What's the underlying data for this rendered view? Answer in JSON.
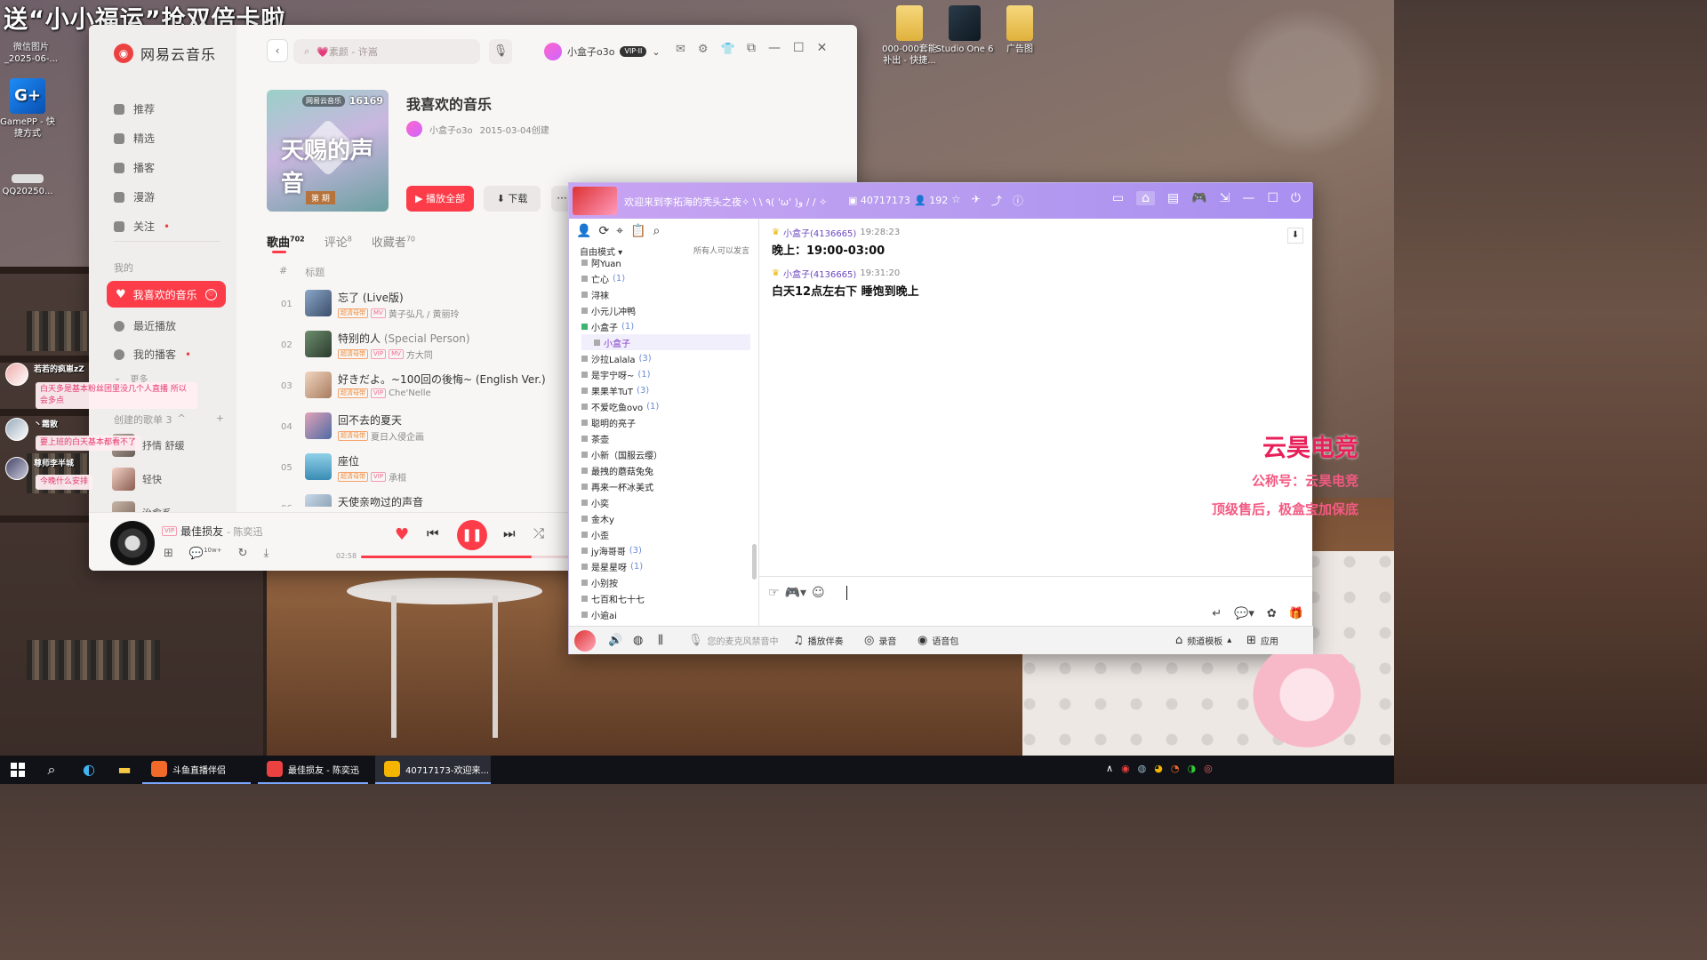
{
  "overlay": {
    "title": "送“小小福运”抢双倍卡啦"
  },
  "desktop": {
    "left_icons": [
      {
        "label": "微信图片_2025-06-..."
      },
      {
        "label": "GamePP - 快捷方式"
      },
      {
        "label": "QQ20250..."
      }
    ],
    "top_icons": [
      {
        "label": "000-000套能补出 - 快捷..."
      },
      {
        "label": "Studio One 6"
      },
      {
        "label": "广告图"
      }
    ]
  },
  "netease": {
    "app_name": "网易云音乐",
    "search_placeholder": "💗素颜 - 许嵩",
    "user_name": "小盒子o3o",
    "vip_label": "VIP·II",
    "nav": [
      {
        "label": "推荐",
        "icon": "home-icon"
      },
      {
        "label": "精选",
        "icon": "star-icon"
      },
      {
        "label": "播客",
        "icon": "radio-icon"
      },
      {
        "label": "漫游",
        "icon": "roam-icon"
      },
      {
        "label": "关注",
        "icon": "follow-icon",
        "dot": "•"
      }
    ],
    "my_section": "我的",
    "liked_label": "我喜欢的音乐",
    "recent_label": "最近播放",
    "podcast_label": "我的播客",
    "podcast_dot": "•",
    "more_label": "更多",
    "created_label": "创建的歌单 3",
    "created_toggle": "^",
    "created_add": "+",
    "mini_playlists": [
      {
        "label": "抒情 舒缓"
      },
      {
        "label": "轻快"
      },
      {
        "label": "治愈系"
      }
    ],
    "cover": {
      "badge": "网易云音乐",
      "count": "16169",
      "big_text": "天赐的声音",
      "season": "第 期"
    },
    "playlist_title": "我喜欢的音乐",
    "owner": "小盒子o3o",
    "created_date": "2015-03-04创建",
    "play_all": "▶ 播放全部",
    "download": "⬇ 下载",
    "more": "···",
    "tabs": [
      {
        "label": "歌曲",
        "count": "702"
      },
      {
        "label": "评论",
        "count": "8"
      },
      {
        "label": "收藏者",
        "count": "70"
      }
    ],
    "col_hash": "#",
    "col_title": "标题",
    "songs": [
      {
        "num": "01",
        "title": "忘了 (Live版)",
        "sub": "",
        "tags": [
          "超清母带",
          "MV"
        ],
        "artist": "黄子弘凡 / 黄丽玲"
      },
      {
        "num": "02",
        "title": "特别的人",
        "sub": "(Special Person)",
        "tags": [
          "超清母带",
          "VIP",
          "MV"
        ],
        "artist": "方大同"
      },
      {
        "num": "03",
        "title": "好きだよ。~100回の後悔~ (English Ver.)",
        "sub": "",
        "tags": [
          "超清母带",
          "VIP"
        ],
        "artist": "Che'Nelle"
      },
      {
        "num": "04",
        "title": "回不去的夏天",
        "sub": "",
        "tags": [
          "超清母带"
        ],
        "artist": "夏日入侵企画"
      },
      {
        "num": "05",
        "title": "座位",
        "sub": "",
        "tags": [
          "超清母带",
          "VIP"
        ],
        "artist": "承桓"
      },
      {
        "num": "06",
        "title": "天使亲吻过的声音",
        "sub": "",
        "tags": [],
        "artist": ""
      }
    ],
    "player": {
      "song": "最佳损友",
      "artist": "- 陈奕迅",
      "vip_tag": "VIP",
      "time": "02:58",
      "progress": 0.82,
      "comment_count": "10w+"
    }
  },
  "chat": {
    "header_title": "欢迎来到李拓海的秃头之夜✧ \\ \\ ٩( 'ω' )و / / ✧",
    "room_id": "40717173",
    "user_count": "192",
    "mode_label": "自由模式 ▾",
    "allow_label": "所有人可以发言",
    "members": [
      {
        "name": "阿Yuan",
        "count": "",
        "type": "normal"
      },
      {
        "name": "亡心",
        "count": "(1)",
        "type": "normal"
      },
      {
        "name": "浔袜",
        "count": "",
        "type": "normal"
      },
      {
        "name": "小元儿冲鸭",
        "count": "",
        "type": "normal"
      },
      {
        "name": "小盒子",
        "count": "(1)",
        "type": "group"
      },
      {
        "name": "小盒子",
        "count": "",
        "type": "self"
      },
      {
        "name": "沙拉Lalala",
        "count": "(3)",
        "type": "normal"
      },
      {
        "name": "是宇宁呀~",
        "count": "(1)",
        "type": "normal"
      },
      {
        "name": "果果羊TuT",
        "count": "(3)",
        "type": "normal"
      },
      {
        "name": "不爱吃鱼ovo",
        "count": "(1)",
        "type": "normal"
      },
      {
        "name": "聪明的亮子",
        "count": "",
        "type": "normal"
      },
      {
        "name": "茶壶",
        "count": "",
        "type": "normal"
      },
      {
        "name": "小新（国服云缨）",
        "count": "",
        "type": "normal"
      },
      {
        "name": "最拽的蘑菇兔兔",
        "count": "",
        "type": "normal"
      },
      {
        "name": "再来一杯冰美式",
        "count": "",
        "type": "normal"
      },
      {
        "name": "小奕",
        "count": "",
        "type": "normal"
      },
      {
        "name": "金木y",
        "count": "",
        "type": "normal"
      },
      {
        "name": "小歪",
        "count": "",
        "type": "normal"
      },
      {
        "name": "jy海哥哥",
        "count": "(3)",
        "type": "normal"
      },
      {
        "name": "是星星呀",
        "count": "(1)",
        "type": "normal"
      },
      {
        "name": "小别按",
        "count": "",
        "type": "normal"
      },
      {
        "name": "七百和七十七",
        "count": "",
        "type": "normal"
      },
      {
        "name": "小逾ai",
        "count": "",
        "type": "normal"
      }
    ],
    "messages": [
      {
        "sender": "小盒子(4136665)",
        "time": "19:28:23",
        "text": "晚上：19:00-03:00"
      },
      {
        "sender": "小盒子(4136665)",
        "time": "19:31:20",
        "text": "白天12点左右下 睡饱到晚上"
      }
    ],
    "bottom": {
      "mic_status": "您的麦克风禁音中",
      "play_accompany": "播放伴奏",
      "record": "录音",
      "voice_pack": "语音包",
      "channel_template": "频道模板",
      "apps": "应用"
    }
  },
  "danmu": [
    {
      "name": "若若的疯崽zZ",
      "text": "白天多是基本粉丝团里没几个人直播 所以会多点"
    },
    {
      "name": "丶霜散",
      "text": "要上班的白天基本都看不了"
    },
    {
      "name": "尊师李半城",
      "text": "今晚什么安排"
    }
  ],
  "sponsor": {
    "name": "云昊电竞",
    "line1": "公称号：云昊电竞",
    "line2": "顶级售后，极盒宝加保底"
  },
  "taskbar": {
    "apps": [
      {
        "label": "斗鱼直播伴侣",
        "color": "#f26a2a"
      },
      {
        "label": "最佳损友 - 陈奕迅",
        "color": "#ec4141"
      },
      {
        "label": "40717173-欢迎来...",
        "color": "#f4b400"
      }
    ]
  }
}
